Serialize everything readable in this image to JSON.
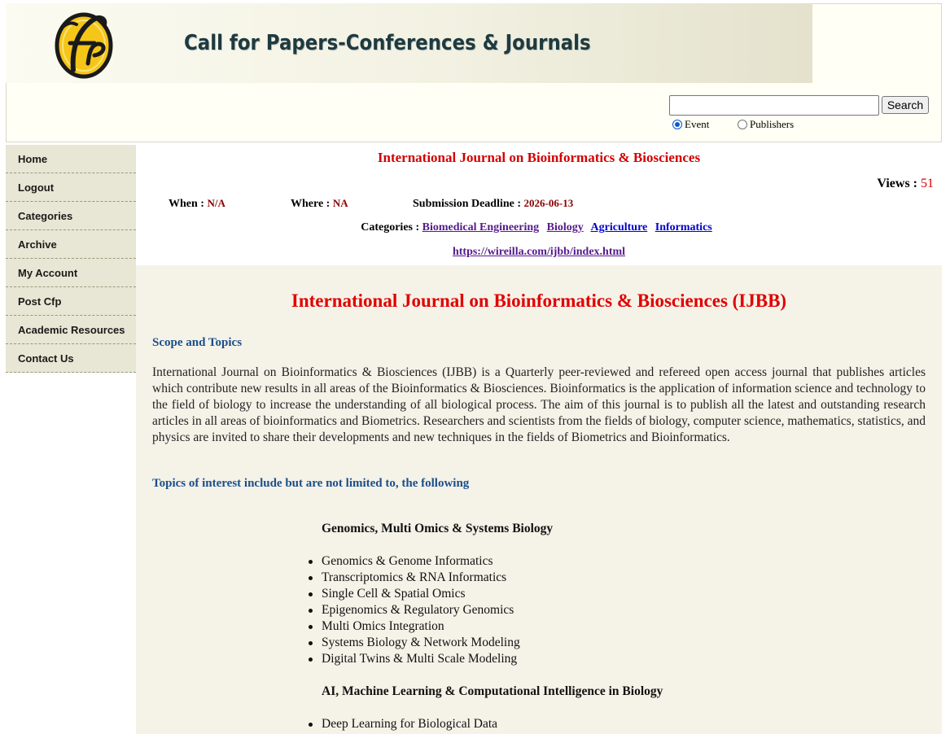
{
  "header": {
    "site_title": "Call for Papers-Conferences & Journals",
    "logo_icon": "cfp-logo-icon"
  },
  "search": {
    "value": "",
    "placeholder": "",
    "button_label": "Search",
    "options": [
      {
        "label": "Event",
        "selected": true
      },
      {
        "label": "Publishers",
        "selected": false
      }
    ]
  },
  "sidebar": {
    "items": [
      {
        "label": "Home"
      },
      {
        "label": "Logout"
      },
      {
        "label": "Categories"
      },
      {
        "label": "Archive"
      },
      {
        "label": "My Account"
      },
      {
        "label": "Post Cfp"
      },
      {
        "label": "Academic Resources"
      },
      {
        "label": "Contact Us"
      }
    ]
  },
  "event": {
    "title": "International Journal on Bioinformatics & Biosciences",
    "views_label": "Views :",
    "views_count": "51",
    "when_label": "When :",
    "when_value": "N/A",
    "where_label": "Where :",
    "where_value": "NA",
    "deadline_label": "Submission Deadline :",
    "deadline_value": "2026-06-13",
    "categories_label": "Categories :",
    "categories": [
      "Biomedical Engineering",
      "Biology",
      "Agriculture",
      "Informatics"
    ],
    "url": "https://wireilla.com/ijbb/index.html"
  },
  "body": {
    "main_title": "International Journal on Bioinformatics & Biosciences (IJBB)",
    "scope_heading": "Scope and Topics",
    "paragraph": "International Journal on Bioinformatics & Biosciences (IJBB) is a Quarterly peer-reviewed and refereed open access journal that publishes articles which contribute new results in all areas of the Bioinformatics & Biosciences. Bioinformatics is the application of information science and technology to the field of biology to increase the understanding of all biological process. The aim of this journal is to publish all the latest and outstanding research articles in all areas of bioinformatics and Biometrics. Researchers and scientists from the fields of biology, computer science, mathematics, statistics, and physics are invited to share their developments and new techniques in the fields of Biometrics and Bioinformatics.",
    "topics_heading": "Topics of interest include but are not limited to, the following",
    "groups": [
      {
        "heading": "Genomics, Multi Omics & Systems Biology",
        "items": [
          "Genomics & Genome Informatics",
          "Transcriptomics & RNA Informatics",
          "Single Cell & Spatial Omics",
          "Epigenomics & Regulatory Genomics",
          "Multi Omics Integration",
          "Systems Biology & Network Modeling",
          "Digital Twins & Multi Scale Modeling"
        ]
      },
      {
        "heading": "AI, Machine Learning & Computational Intelligence in Biology",
        "items": [
          "Deep Learning for Biological Data"
        ]
      }
    ]
  }
}
